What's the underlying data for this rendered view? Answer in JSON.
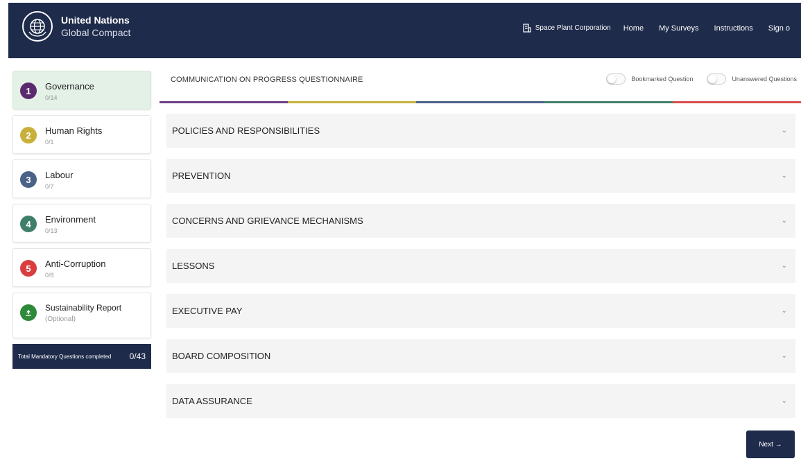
{
  "header": {
    "brand_line1": "United Nations",
    "brand_line2": "Global Compact",
    "company": "Space Plant Corporation",
    "nav": [
      "Home",
      "My Surveys",
      "Instructions",
      "Sign o"
    ],
    "bg_color": "#1e2b4a"
  },
  "sidebar": {
    "items": [
      {
        "badge": "1",
        "label": "Governance",
        "count": "0/14",
        "color": "#5b2a6e",
        "active": true
      },
      {
        "badge": "2",
        "label": "Human Rights",
        "count": "0/1",
        "color": "#c9b03a",
        "active": false
      },
      {
        "badge": "3",
        "label": "Labour",
        "count": "0/7",
        "color": "#4a6188",
        "active": false
      },
      {
        "badge": "4",
        "label": "Environment",
        "count": "0/13",
        "color": "#3f7f6a",
        "active": false
      },
      {
        "badge": "5",
        "label": "Anti-Corruption",
        "count": "0/8",
        "color": "#d93d3d",
        "active": false
      },
      {
        "badge": "",
        "icon": "upload-icon",
        "label": "Sustainability Report",
        "count": "(Optional)",
        "color": "#2e8a3a",
        "active": false
      }
    ],
    "total_label": "Total Mandatory Questions completed",
    "total_value": "0/43"
  },
  "main": {
    "title": "COMMUNICATION ON PROGRESS QUESTIONNAIRE",
    "toggle1": "Bookmarked Question",
    "toggle2": "Unanswered Questions",
    "stripe_colors": [
      "#6b3f86",
      "#c9b03a",
      "#4a6188",
      "#3f7f6a",
      "#d94a4a"
    ],
    "sections": [
      "POLICIES AND RESPONSIBILITIES",
      "PREVENTION",
      "CONCERNS AND GRIEVANCE MECHANISMS",
      "LESSONS",
      "EXECUTIVE PAY",
      "BOARD COMPOSITION",
      "DATA ASSURANCE"
    ],
    "next_label": "Next →"
  }
}
